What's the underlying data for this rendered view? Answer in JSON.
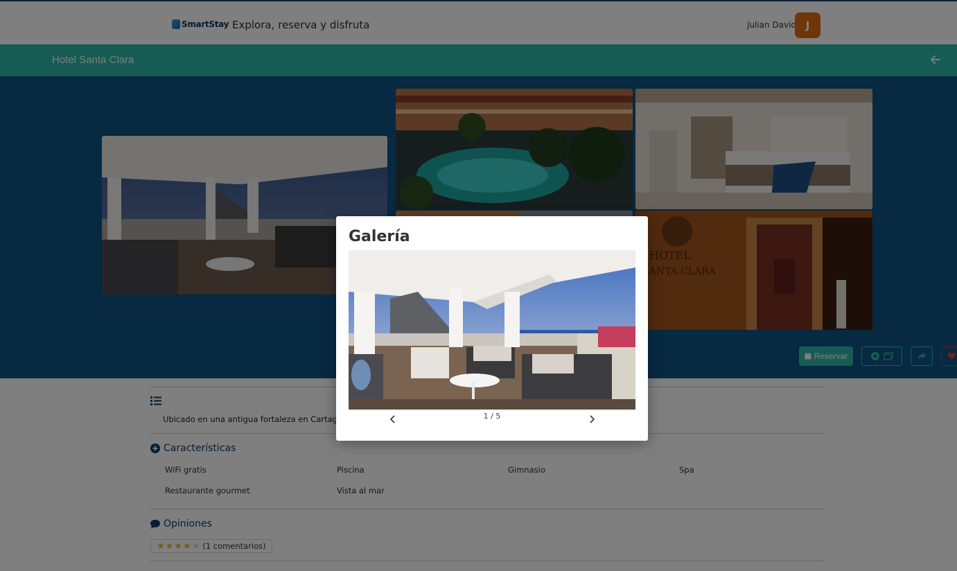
{
  "header": {
    "logo_text": "SmartStay",
    "tagline": "Explora, reserva y disfruta",
    "username": "julian David",
    "avatar_initial": "J"
  },
  "hotel": {
    "name": "Hotel Santa Clara"
  },
  "actions": {
    "reserve_label": "Reservar"
  },
  "sections": {
    "description": "Ubicado en una antigua fortaleza en Cartagena",
    "features_title": "Características",
    "features": [
      "WiFi gratis",
      "Piscina",
      "Gimnasio",
      "Spa",
      "Restaurante gourmet",
      "Vista al mar"
    ],
    "reviews_title": "Opiniones",
    "rating": 4,
    "rating_max": 5,
    "comments": "(1 comentarios)"
  },
  "modal": {
    "title": "Galería",
    "counter": "1 / 5"
  },
  "colors": {
    "teal": "#2fb9a9",
    "hero_blue": "#0e5385",
    "avatar_orange": "#e16a10",
    "heading_navy": "#0f3c66",
    "star_gold": "#f0b323"
  }
}
